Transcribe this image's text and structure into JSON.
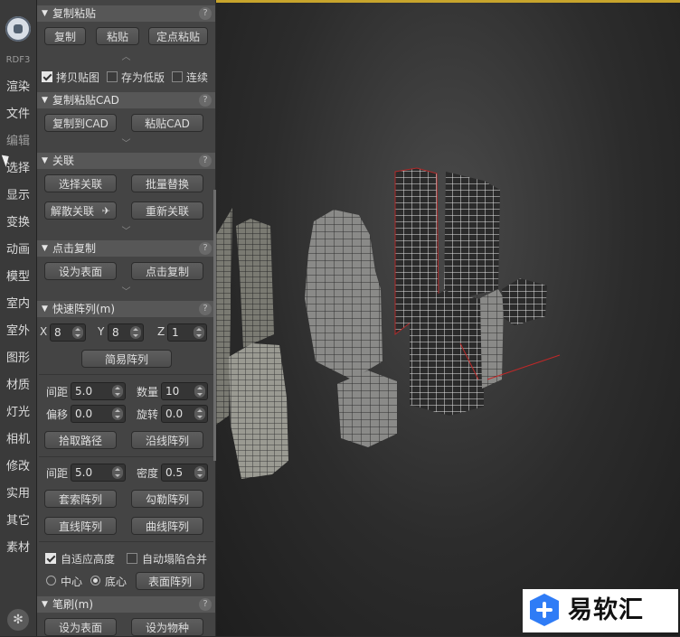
{
  "tabs": [
    "RDF3",
    "渲染",
    "文件",
    "编辑",
    "选择",
    "显示",
    "变换",
    "动画",
    "模型",
    "室内",
    "室外",
    "图形",
    "材质",
    "灯光",
    "相机",
    "修改",
    "实用",
    "其它",
    "素材"
  ],
  "help_glyph": "?",
  "chevron_glyph": "︿",
  "chevron_down_glyph": "﹀",
  "sections": {
    "copy_paste": {
      "title": "复制粘贴",
      "copy": "复制",
      "paste": "粘贴",
      "paste_fixed": "定点粘贴",
      "copy_map": "拷贝贴图",
      "save_low": "存为低版",
      "continuous": "连续"
    },
    "cad": {
      "title": "复制粘贴CAD",
      "copy_to_cad": "复制到CAD",
      "paste_cad": "粘贴CAD"
    },
    "link": {
      "title": "关联",
      "select_link": "选择关联",
      "batch_replace": "批量替换",
      "unlink": "解散关联",
      "relink": "重新关联"
    },
    "click_copy": {
      "title": "点击复制",
      "set_surface": "设为表面",
      "click_copy": "点击复制"
    },
    "quick_array": {
      "title": "快速阵列(m)",
      "x_label": "X",
      "x_value": "8",
      "y_label": "Y",
      "y_value": "8",
      "z_label": "Z",
      "z_value": "1",
      "simple_array": "简易阵列",
      "spacing_label": "间距",
      "spacing_value": "5.0",
      "count_label": "数量",
      "count_value": "10",
      "offset_label": "偏移",
      "offset_value": "0.0",
      "rotate_label": "旋转",
      "rotate_value": "0.0",
      "pick_path": "拾取路径",
      "along_line": "沿线阵列",
      "spacing2_label": "间距",
      "spacing2_value": "5.0",
      "density_label": "密度",
      "density_value": "0.5",
      "lasso_array": "套索阵列",
      "outline_array": "勾勒阵列",
      "line_array": "直线阵列",
      "curve_array": "曲线阵列",
      "adaptive_height": "自适应高度",
      "auto_collapse": "自动塌陷合并",
      "center": "中心",
      "bottom": "底心",
      "surface_array": "表面阵列"
    },
    "brush": {
      "title": "笔刷(m)",
      "set_surface": "设为表面",
      "set_object": "设为物种"
    }
  },
  "watermark": {
    "text": "易软汇"
  },
  "colors": {
    "accent": "#c7a42c",
    "panel": "#444444",
    "header": "#575757",
    "watermark_blue": "#2f7cf6"
  }
}
